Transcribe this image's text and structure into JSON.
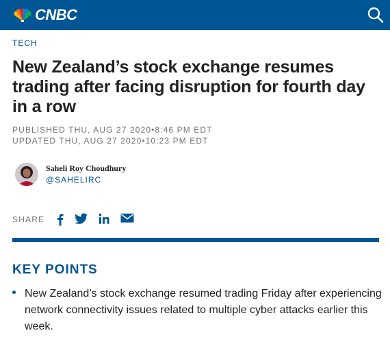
{
  "header": {
    "brand": "CNBC",
    "logo_icon": "nbc-peacock-icon",
    "search_icon": "search-icon",
    "brand_color": "#005594"
  },
  "article": {
    "section": "TECH",
    "headline": "New Zealand’s stock exchange resumes trading after facing disruption for fourth day in a row",
    "published": "PUBLISHED THU, AUG 27 2020•8:46 PM EDT",
    "updated": "UPDATED THU, AUG 27 2020•10:23 PM EDT"
  },
  "author": {
    "name": "Saheli Roy Choudhury",
    "handle": "@SAHELIRC"
  },
  "share": {
    "label": "SHARE",
    "icons": [
      "facebook-icon",
      "twitter-icon",
      "linkedin-icon",
      "email-icon"
    ]
  },
  "key_points": {
    "title": "KEY POINTS",
    "items": [
      "New Zealand’s stock exchange resumed trading Friday after experiencing network connectivity issues related to multiple cyber attacks earlier this week."
    ]
  }
}
